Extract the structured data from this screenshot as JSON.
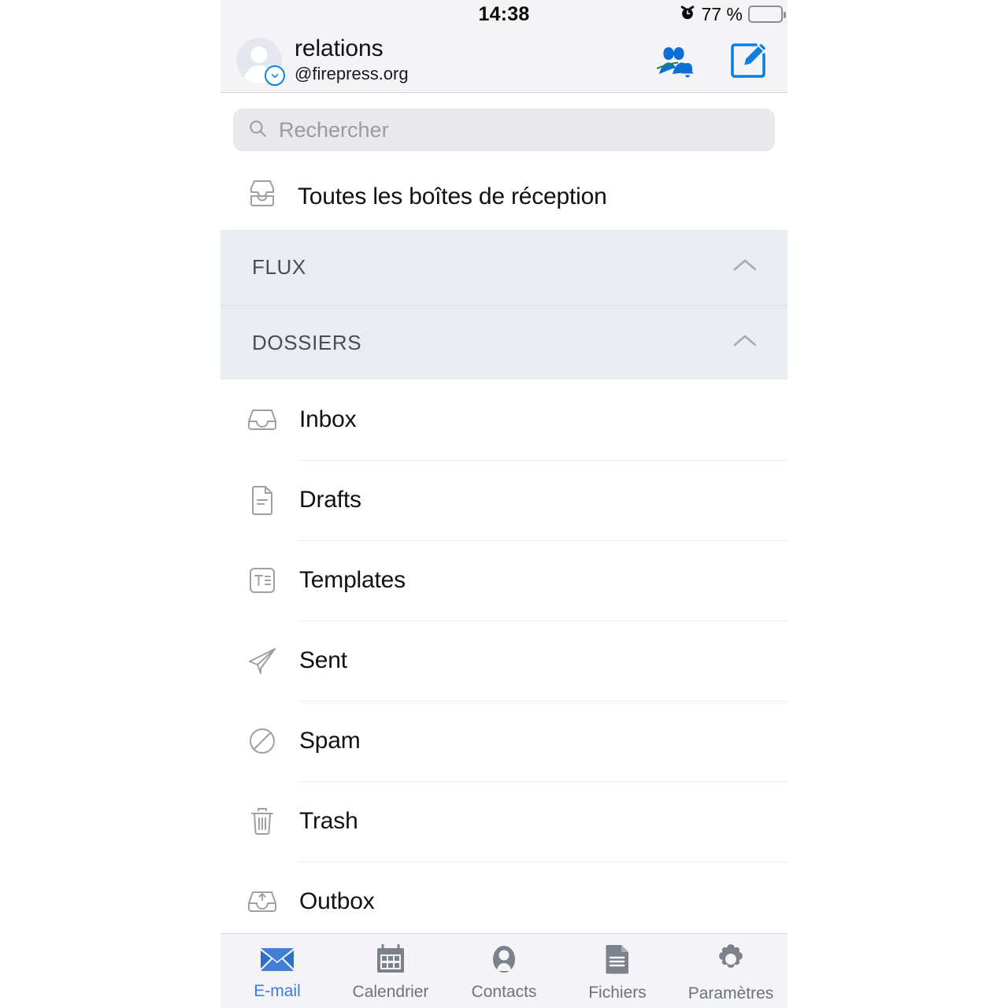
{
  "status_bar": {
    "time": "14:38",
    "battery_percent": "77 %",
    "battery_level": 77,
    "alarm_icon": "alarm-clock-icon"
  },
  "header": {
    "account_name": "relations",
    "account_email": "@firepress.org",
    "avatar_icon": "avatar-person-icon",
    "avatar_badge_icon": "chevron-down-badge-icon",
    "actions": [
      {
        "name": "contacts-notifications-button",
        "icon": "people-bell-icon"
      },
      {
        "name": "compose-button",
        "icon": "compose-pencil-icon"
      }
    ]
  },
  "search": {
    "placeholder": "Rechercher",
    "icon": "search-icon",
    "value": ""
  },
  "all_inboxes": {
    "label": "Toutes les boîtes de réception",
    "icon": "all-inboxes-stacked-tray-icon"
  },
  "sections": [
    {
      "title": "FLUX",
      "toggle_icon": "chevron-up-icon",
      "expanded": true
    },
    {
      "title": "DOSSIERS",
      "toggle_icon": "chevron-up-icon",
      "expanded": true
    }
  ],
  "folders": [
    {
      "label": "Inbox",
      "icon": "inbox-tray-icon"
    },
    {
      "label": "Drafts",
      "icon": "draft-document-icon"
    },
    {
      "label": "Templates",
      "icon": "templates-text-box-icon"
    },
    {
      "label": "Sent",
      "icon": "sent-paper-plane-icon"
    },
    {
      "label": "Spam",
      "icon": "spam-no-entry-icon"
    },
    {
      "label": "Trash",
      "icon": "trash-can-icon"
    },
    {
      "label": "Outbox",
      "icon": "outbox-upload-tray-icon"
    }
  ],
  "tab_bar": [
    {
      "label": "E-mail",
      "icon": "envelope-icon",
      "active": true
    },
    {
      "label": "Calendrier",
      "icon": "calendar-icon",
      "active": false
    },
    {
      "label": "Contacts",
      "icon": "contact-person-icon",
      "active": false
    },
    {
      "label": "Fichiers",
      "icon": "file-document-icon",
      "active": false
    },
    {
      "label": "Paramètres",
      "icon": "gear-icon",
      "active": false
    }
  ],
  "colors": {
    "accent_blue": "#0c84e4",
    "tab_active_blue": "#3b7dd8",
    "tab_inactive_gray": "#6b7280",
    "header_bg": "#f4f4f6",
    "section_bg": "#e9ecf1",
    "search_bg": "#e9e9ec"
  }
}
